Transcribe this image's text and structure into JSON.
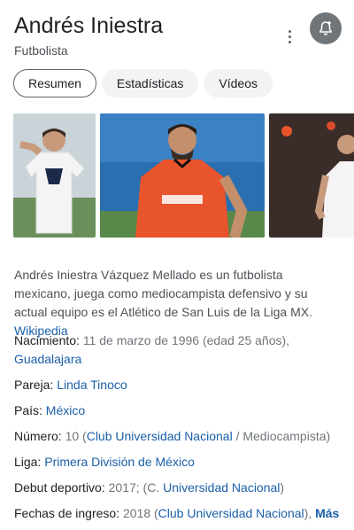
{
  "header": {
    "title": "Andrés Iniestra",
    "subtitle": "Futbolista"
  },
  "tabs": [
    {
      "label": "Resumen",
      "active": true
    },
    {
      "label": "Estadísticas",
      "active": false
    },
    {
      "label": "Vídeos",
      "active": false
    }
  ],
  "description": {
    "text": "Andrés Iniestra Vázquez Mellado es un futbolista mexicano, juega como mediocampista defensivo y su actual equipo es el Atlético de San Luis de la Liga MX.",
    "source": "Wikipedia"
  },
  "facts": {
    "nacimiento": {
      "label": "Nacimiento:",
      "value": "11 de marzo de 1996 (edad 25 años),",
      "link": "Guadalajara"
    },
    "pareja": {
      "label": "Pareja:",
      "link": "Linda Tinoco"
    },
    "pais": {
      "label": "País:",
      "link": "México"
    },
    "numero": {
      "label": "Número:",
      "value_pre": "10 (",
      "link": "Club Universidad Nacional",
      "value_post": " / Mediocampista)"
    },
    "liga": {
      "label": "Liga:",
      "link": "Primera División de México"
    },
    "debut": {
      "label": "Debut deportivo:",
      "value_pre": "2017; (C. ",
      "link": "Universidad Nacional",
      "value_post": ")"
    },
    "ingreso": {
      "label": "Fechas de ingreso:",
      "value_pre": "2018 (",
      "link": "Club Universidad Nacional",
      "value_post": "),",
      "more": "Más"
    }
  },
  "colors": {
    "link": "#1a5fa8",
    "jersey_orange": "#e8542c",
    "jersey_white": "#f4f4f4"
  }
}
